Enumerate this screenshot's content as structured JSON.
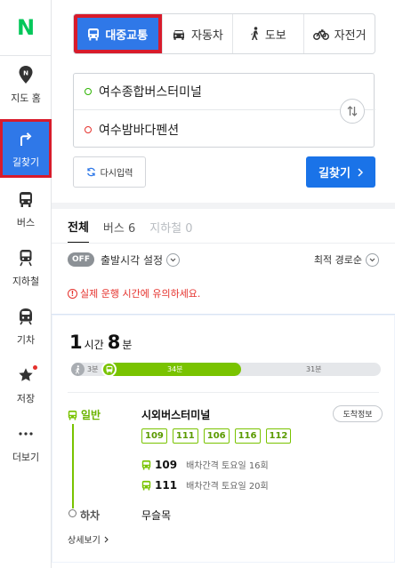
{
  "brand": {
    "logo": "N"
  },
  "sidebar": {
    "items": [
      {
        "label": "지도 홈",
        "icon": "map-pin-icon"
      },
      {
        "label": "길찾기",
        "icon": "directions-icon",
        "active": true
      },
      {
        "label": "버스",
        "icon": "bus-icon"
      },
      {
        "label": "지하철",
        "icon": "subway-icon"
      },
      {
        "label": "기차",
        "icon": "train-icon"
      },
      {
        "label": "저장",
        "icon": "star-icon",
        "badge": true
      },
      {
        "label": "더보기",
        "icon": "more-icon"
      }
    ]
  },
  "modes": {
    "transit": "대중교통",
    "car": "자동차",
    "walk": "도보",
    "bike": "자전거"
  },
  "route": {
    "origin": "여수종합버스터미널",
    "destination": "여수밤바다펜션"
  },
  "buttons": {
    "reset": "다시입력",
    "search": "길찾기"
  },
  "tabs": {
    "all": "전체",
    "bus": "버스 6",
    "subway": "지하철 0"
  },
  "options": {
    "toggle": "OFF",
    "departure": "출발시각 설정",
    "sort": "최적 경로순"
  },
  "notice": "실제 운행 시간에 유의하세요.",
  "result": {
    "hours": "1",
    "hours_unit": "시간",
    "minutes": "8",
    "minutes_unit": "분",
    "timeline": {
      "walk_label": "3분",
      "bus_label": "34분",
      "rest_label": "31분",
      "walk_minutes": 3,
      "bus_minutes": 34,
      "rest_minutes": 31
    },
    "segment_type": "일반",
    "board_stop": "시외버스터미널",
    "arrival_info": "도착정보",
    "chips": [
      "109",
      "111",
      "106",
      "116",
      "112"
    ],
    "buses": [
      {
        "number": "109",
        "info": "배차간격 토요일 16회"
      },
      {
        "number": "111",
        "info": "배차간격 토요일 20회"
      }
    ],
    "alight_label": "하차",
    "alight_stop": "무슬목",
    "detail_link": "상세보기"
  },
  "colors": {
    "accent": "#2f78e8",
    "search_button": "#1a73e8",
    "bus_green": "#79c300",
    "highlight_red": "#d81b2b",
    "logo_green": "#03c75a"
  }
}
